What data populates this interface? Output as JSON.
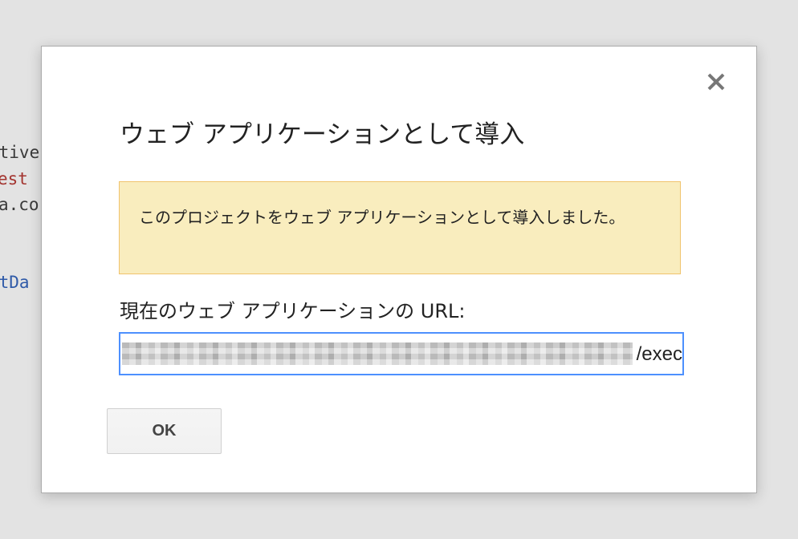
{
  "background_code": {
    "line1": "ctive",
    "line2": "est",
    "line3": "a.co",
    "line4": "stDa"
  },
  "dialog": {
    "title": "ウェブ アプリケーションとして導入",
    "close_icon": "close-icon",
    "notice": {
      "text": "このプロジェクトをウェブ アプリケーションとして導入しました。",
      "background_color": "#f9edbe",
      "border_color": "#f0c36d"
    },
    "url_label": "現在のウェブ アプリケーションの URL:",
    "url_field": {
      "visible_suffix": "/exec",
      "focus_color": "#4d90fe"
    },
    "ok_label": "OK"
  }
}
